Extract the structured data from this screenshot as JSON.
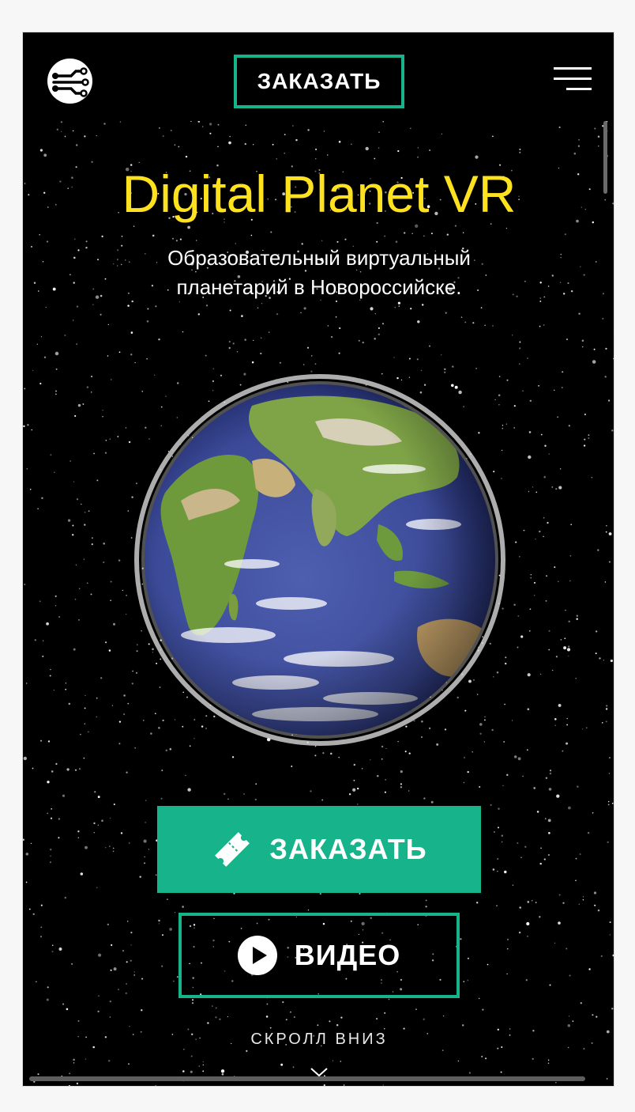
{
  "header": {
    "logo_icon": "circuit-logo-icon",
    "order_label": "ЗАКАЗАТЬ",
    "menu_icon": "hamburger-menu-icon"
  },
  "hero": {
    "title": "Digital Planet VR",
    "subtitle": "Образовательный виртуальный планетарий в Новороссийске.",
    "image": "earth-globe",
    "order_button": {
      "label": "ЗАКАЗАТЬ",
      "icon": "ticket-icon"
    },
    "video_button": {
      "label": "ВИДЕО",
      "icon": "play-icon"
    },
    "scroll_hint": {
      "label": "СКРОЛЛ ВНИЗ",
      "icon": "chevron-down-icon"
    }
  },
  "colors": {
    "accent": "#17b48c",
    "title": "#ffe21f",
    "background": "#000000",
    "text": "#ffffff"
  }
}
